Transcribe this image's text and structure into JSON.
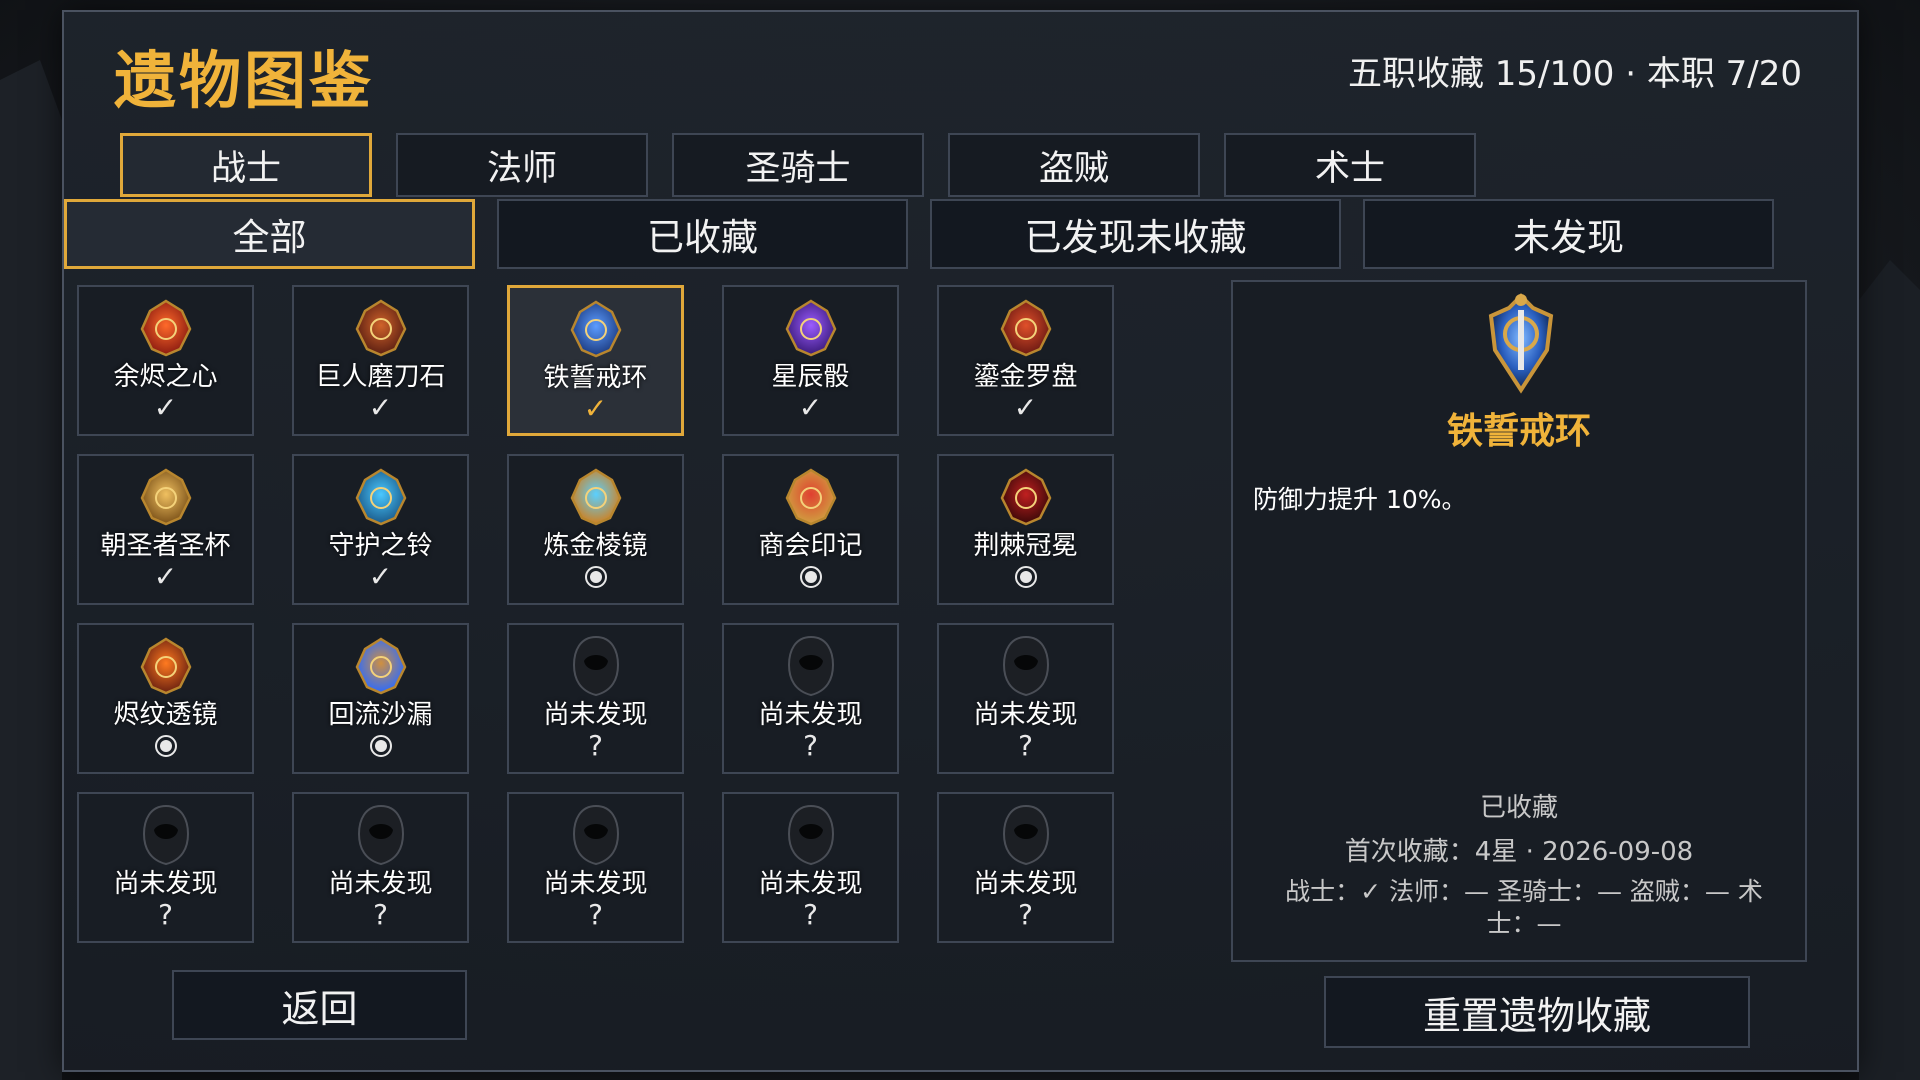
{
  "header": {
    "title": "遗物图鉴",
    "stats": "五职收藏 15/100 · 本职 7/20"
  },
  "class_tabs": [
    {
      "label": "战士",
      "active": true
    },
    {
      "label": "法师",
      "active": false
    },
    {
      "label": "圣骑士",
      "active": false
    },
    {
      "label": "盗贼",
      "active": false
    },
    {
      "label": "术士",
      "active": false
    }
  ],
  "filter_tabs": [
    {
      "label": "全部",
      "active": true
    },
    {
      "label": "已收藏",
      "active": false
    },
    {
      "label": "已发现未收藏",
      "active": false
    },
    {
      "label": "未发现",
      "active": false
    }
  ],
  "relics": [
    {
      "name": "余烬之心",
      "state": "collected",
      "mark": "✓",
      "icon": "ember-heart-icon"
    },
    {
      "name": "巨人磨刀石",
      "state": "collected",
      "mark": "✓",
      "icon": "giant-whetstone-icon"
    },
    {
      "name": "铁誓戒环",
      "state": "collected",
      "mark": "✓",
      "icon": "iron-oath-ring-icon",
      "selected": true
    },
    {
      "name": "星辰骰",
      "state": "collected",
      "mark": "✓",
      "icon": "star-dice-icon"
    },
    {
      "name": "鎏金罗盘",
      "state": "collected",
      "mark": "✓",
      "icon": "gilded-compass-icon"
    },
    {
      "name": "朝圣者圣杯",
      "state": "collected",
      "mark": "✓",
      "icon": "pilgrim-chalice-icon"
    },
    {
      "name": "守护之铃",
      "state": "collected",
      "mark": "✓",
      "icon": "guardian-bell-icon"
    },
    {
      "name": "炼金棱镜",
      "state": "discovered",
      "mark": "",
      "icon": "alchemy-prism-icon"
    },
    {
      "name": "商会印记",
      "state": "discovered",
      "mark": "",
      "icon": "guild-seal-icon"
    },
    {
      "name": "荆棘冠冕",
      "state": "discovered",
      "mark": "",
      "icon": "thorn-crown-icon"
    },
    {
      "name": "烬纹透镜",
      "state": "discovered",
      "mark": "",
      "icon": "ember-lens-icon"
    },
    {
      "name": "回流沙漏",
      "state": "discovered",
      "mark": "",
      "icon": "reflux-hourglass-icon"
    },
    {
      "name": "尚未发现",
      "state": "unknown",
      "mark": "?",
      "icon": "hooded-unknown-icon"
    },
    {
      "name": "尚未发现",
      "state": "unknown",
      "mark": "?",
      "icon": "hooded-unknown-icon"
    },
    {
      "name": "尚未发现",
      "state": "unknown",
      "mark": "?",
      "icon": "hooded-unknown-icon"
    },
    {
      "name": "尚未发现",
      "state": "unknown",
      "mark": "?",
      "icon": "hooded-unknown-icon"
    },
    {
      "name": "尚未发现",
      "state": "unknown",
      "mark": "?",
      "icon": "hooded-unknown-icon"
    },
    {
      "name": "尚未发现",
      "state": "unknown",
      "mark": "?",
      "icon": "hooded-unknown-icon"
    },
    {
      "name": "尚未发现",
      "state": "unknown",
      "mark": "?",
      "icon": "hooded-unknown-icon"
    },
    {
      "name": "尚未发现",
      "state": "unknown",
      "mark": "?",
      "icon": "hooded-unknown-icon"
    }
  ],
  "detail": {
    "icon": "iron-oath-ring-icon",
    "name": "铁誓戒环",
    "description": "防御力提升 10%。",
    "status": "已收藏",
    "first_collected": "首次收藏：4星 · 2026-09-08",
    "class_status": "战士：✓ 法师：— 圣骑士：— 盗贼：— 术士：—"
  },
  "buttons": {
    "back": "返回",
    "reset": "重置遗物收藏"
  },
  "colors": {
    "accent": "#e0a83a",
    "title": "#f0b33a",
    "border": "#3e4654"
  }
}
